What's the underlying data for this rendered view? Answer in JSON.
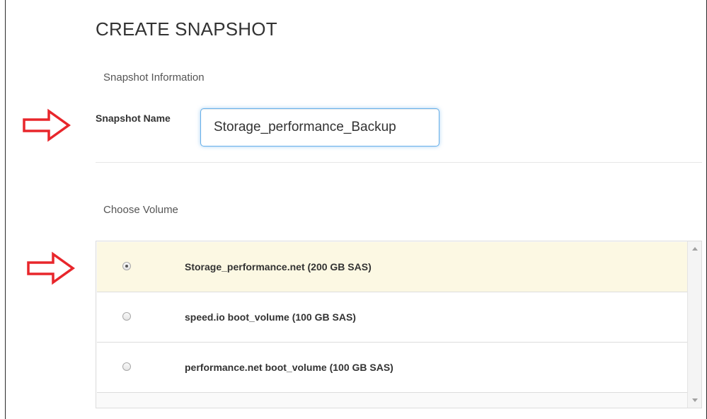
{
  "page": {
    "title": "CREATE SNAPSHOT"
  },
  "snapshot_info": {
    "heading": "Snapshot Information",
    "name_label": "Snapshot Name",
    "name_value": "Storage_performance_Backup"
  },
  "volume_section": {
    "heading": "Choose Volume",
    "options": [
      {
        "label": "Storage_performance.net (200 GB SAS)",
        "selected": true
      },
      {
        "label": "speed.io boot_volume (100 GB SAS)",
        "selected": false
      },
      {
        "label": "performance.net boot_volume (100 GB SAS)",
        "selected": false
      }
    ]
  },
  "annotations": {
    "arrow_color": "#e8262b",
    "arrow_icon": "right-arrow-outline-icon"
  },
  "theme": {
    "selected_row_bg": "#fcf8e3",
    "input_focus_border": "#66afe9"
  }
}
